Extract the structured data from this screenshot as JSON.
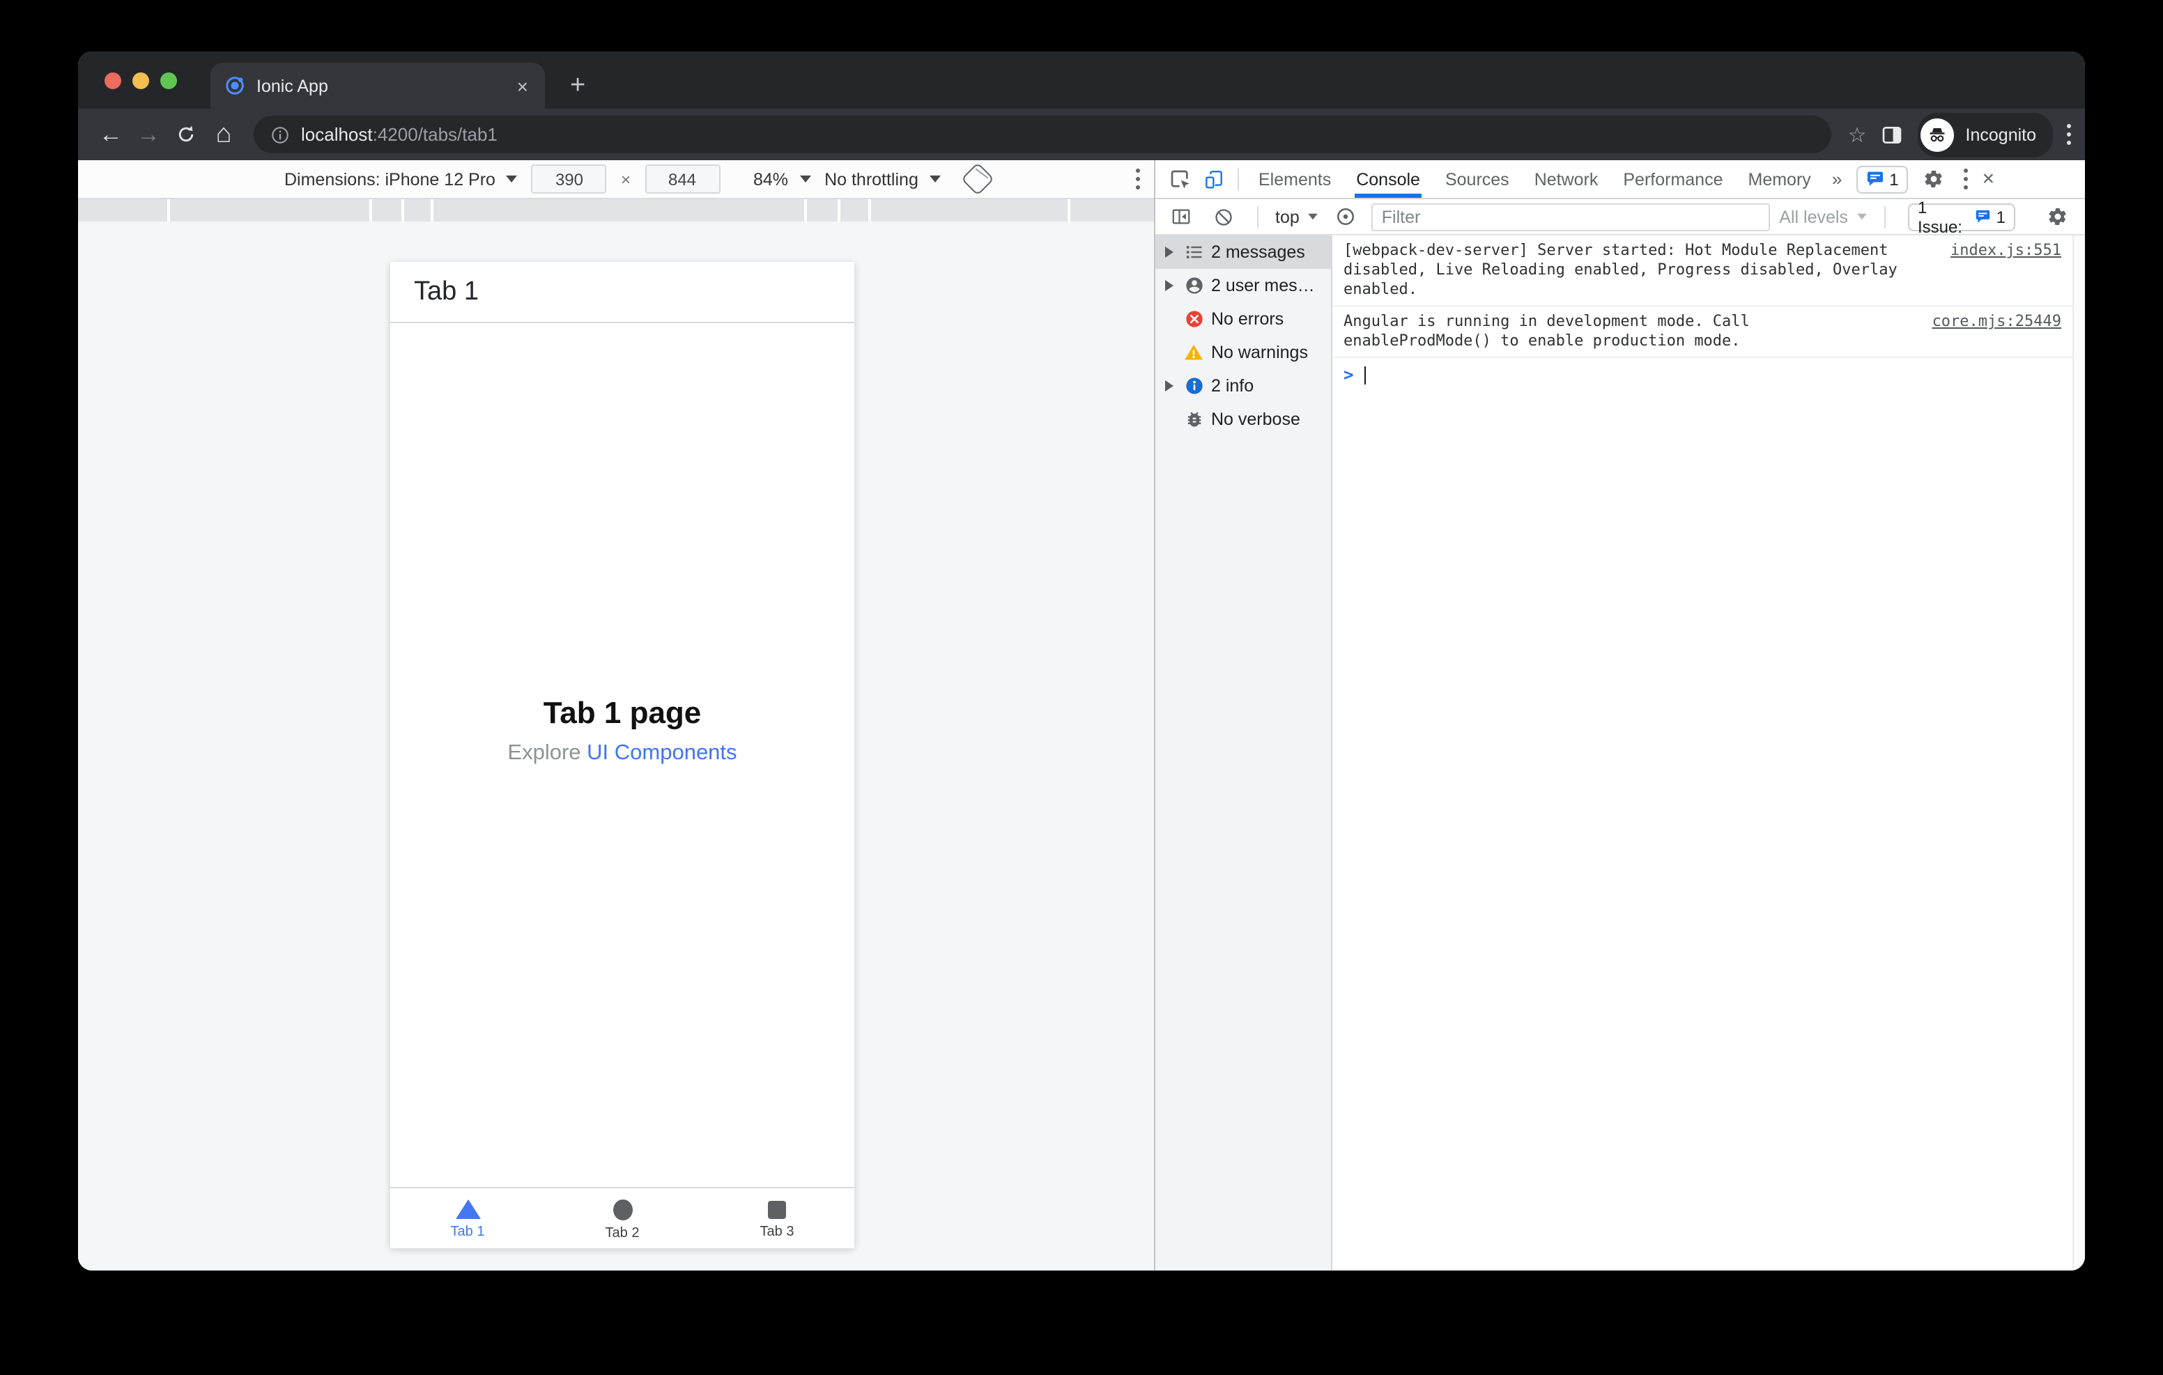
{
  "tab_strip": {
    "tab_title": "Ionic App",
    "new_tab_glyph": "+",
    "close_glyph": "×"
  },
  "toolbar": {
    "back_glyph": "←",
    "forward_glyph": "→",
    "home_glyph": "⌂",
    "star_glyph": "☆",
    "url_host": "localhost",
    "url_rest": ":4200/tabs/tab1",
    "incognito_label": "Incognito"
  },
  "device_toolbar": {
    "dimensions_label": "Dimensions: iPhone 12 Pro",
    "width_value": "390",
    "times_glyph": "×",
    "height_value": "844",
    "zoom_value": "84%",
    "throttling_value": "No throttling"
  },
  "app": {
    "header_title": "Tab 1",
    "page_title": "Tab 1 page",
    "explore_text": "Explore ",
    "explore_link": "UI Components",
    "tabs": [
      {
        "label": "Tab 1",
        "icon": "triangle",
        "active": true
      },
      {
        "label": "Tab 2",
        "icon": "circle",
        "active": false
      },
      {
        "label": "Tab 3",
        "icon": "square",
        "active": false
      }
    ]
  },
  "devtools": {
    "tabs": [
      "Elements",
      "Console",
      "Sources",
      "Network",
      "Performance",
      "Memory"
    ],
    "active_tab": "Console",
    "more_tabs_glyph": "»",
    "issues_badge_count": "1",
    "close_glyph": "×",
    "console_toolbar": {
      "context_label": "top",
      "filter_placeholder": "Filter",
      "levels_label": "All levels",
      "issues_label": "1 Issue:",
      "issues_count": "1"
    },
    "sidebar": [
      {
        "label": "2 messages",
        "icon": "list-icon",
        "selected": true
      },
      {
        "label": "2 user mes…",
        "icon": "user-icon",
        "selected": false
      },
      {
        "label": "No errors",
        "icon": "error-icon",
        "selected": false
      },
      {
        "label": "No warnings",
        "icon": "warning-icon",
        "selected": false
      },
      {
        "label": "2 info",
        "icon": "info-icon",
        "selected": false
      },
      {
        "label": "No verbose",
        "icon": "bug-icon",
        "selected": false
      }
    ],
    "messages": [
      {
        "text": "[webpack-dev-server] Server started: Hot Module Replacement\ndisabled, Live Reloading enabled, Progress disabled, Overlay enabled.",
        "source": "index.js:551"
      },
      {
        "text": "Angular is running in development mode. Call\nenableProdMode() to enable production mode.",
        "source": "core.mjs:25449"
      }
    ],
    "prompt_glyph": ">"
  },
  "colors": {
    "accent_blue": "#1a73e8",
    "ionic_blue": "#3d78f4",
    "error_red": "#ea4335",
    "warning_yellow": "#f5b400",
    "info_blue": "#1a73e8",
    "chrome_dark": "#35363b"
  }
}
